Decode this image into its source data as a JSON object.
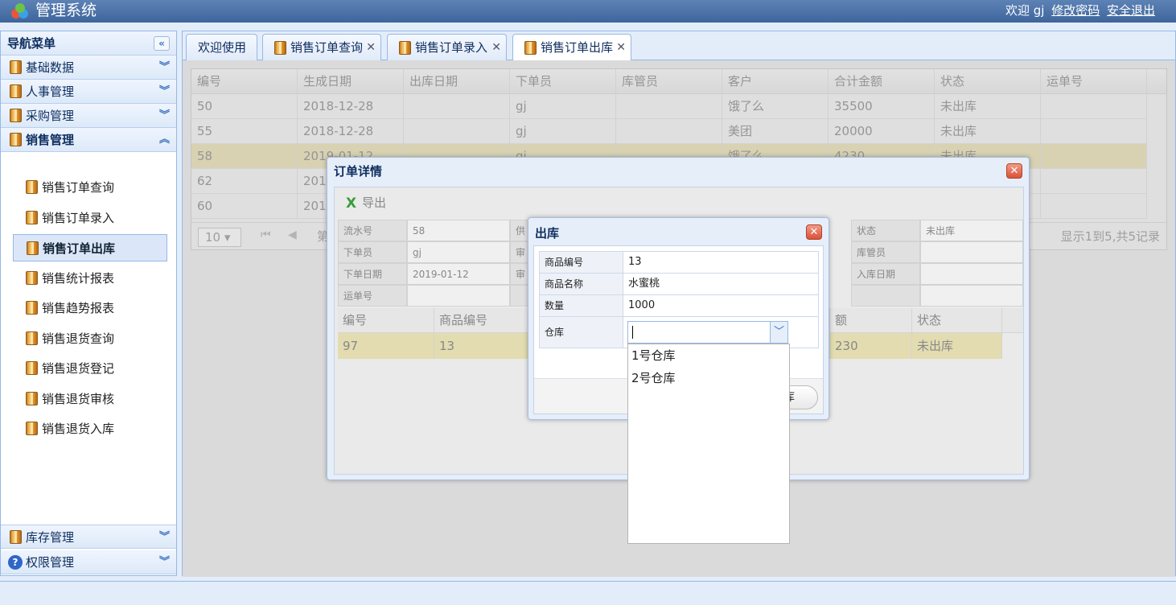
{
  "header": {
    "title": "管理系统",
    "welcome": "欢迎 gj",
    "change_password": "修改密码",
    "logout": "安全退出"
  },
  "sidebar": {
    "title": "导航菜单",
    "collapse_icon": "«",
    "groups_top": [
      "基础数据",
      "人事管理",
      "采购管理"
    ],
    "active_group": "销售管理",
    "items": [
      "销售订单查询",
      "销售订单录入",
      "销售订单出库",
      "销售统计报表",
      "销售趋势报表",
      "销售退货查询",
      "销售退货登记",
      "销售退货审核",
      "销售退货入库"
    ],
    "selected_item": "销售订单出库",
    "groups_bottom": [
      "库存管理",
      "权限管理"
    ]
  },
  "tabs": [
    {
      "label": "欢迎使用",
      "closable": false
    },
    {
      "label": "销售订单查询",
      "closable": true
    },
    {
      "label": "销售订单录入",
      "closable": true
    },
    {
      "label": "销售订单出库",
      "closable": true,
      "active": true
    }
  ],
  "grid": {
    "columns": [
      "编号",
      "生成日期",
      "出库日期",
      "下单员",
      "库管员",
      "客户",
      "合计金额",
      "状态",
      "运单号"
    ],
    "rows": [
      [
        "50",
        "2018-12-28",
        "",
        "gj",
        "",
        "饿了么",
        "35500",
        "未出库",
        ""
      ],
      [
        "55",
        "2018-12-28",
        "",
        "gj",
        "",
        "美团",
        "20000",
        "未出库",
        ""
      ],
      [
        "58",
        "2019-01-12",
        "",
        "gj",
        "",
        "饿了么",
        "4230",
        "未出库",
        ""
      ],
      [
        "62",
        "2019",
        "",
        "",
        "",
        "",
        "",
        "",
        ""
      ],
      [
        "60",
        "2019",
        "",
        "",
        "",
        "",
        "",
        "",
        ""
      ]
    ],
    "selected_row": 2,
    "page_size": "10 ▾",
    "page_prefix": "第",
    "summary": "显示1到5,共5记录"
  },
  "order_dialog": {
    "title": "订单详情",
    "export_label": "导出",
    "info": [
      [
        "流水号",
        "58",
        "供应",
        "状态",
        "未出库"
      ],
      [
        "下单员",
        "gj",
        "审核",
        "库管员",
        ""
      ],
      [
        "下单日期",
        "2019-01-12",
        "审核",
        "入库日期",
        ""
      ],
      [
        "运单号",
        "",
        "",
        "",
        ""
      ]
    ],
    "item_columns": [
      "编号",
      "商品编号",
      "额",
      "状态"
    ],
    "item_rows": [
      [
        "97",
        "13",
        "230",
        "未出库"
      ]
    ]
  },
  "stock_dialog": {
    "title": "出库",
    "fields": [
      {
        "label": "商品编号",
        "value": "13"
      },
      {
        "label": "商品名称",
        "value": "水蜜桃"
      },
      {
        "label": "数量",
        "value": "1000"
      },
      {
        "label": "仓库",
        "value": ""
      }
    ],
    "button_fragment": "库",
    "warehouse_options": [
      "1号仓库",
      "2号仓库"
    ]
  },
  "colors": {
    "brand_bar": "#4a70a6",
    "selected_row": "#fcf4c4",
    "border": "#95b8e7"
  }
}
